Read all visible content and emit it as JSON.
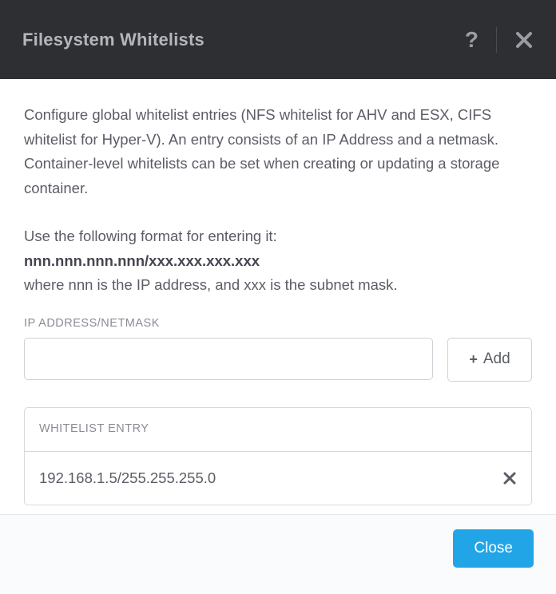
{
  "header": {
    "title": "Filesystem Whitelists",
    "help_tooltip": "?",
    "close_label": "Close"
  },
  "body": {
    "description": "Configure global whitelist entries (NFS whitelist for AHV and ESX, CIFS whitelist for Hyper-V). An entry consists of an IP Address and a netmask. Container-level whitelists can be set when creating or updating a storage container.",
    "format_intro": "Use the following format for entering it:",
    "format_example": "nnn.nnn.nnn.nnn/xxx.xxx.xxx.xxx",
    "format_note": "where nnn is the IP address, and xxx is the subnet mask.",
    "ip_label": "IP ADDRESS/NETMASK",
    "ip_value": "",
    "add_button_label": "Add",
    "list_header": "WHITELIST ENTRY",
    "entries": [
      {
        "value": "192.168.1.5/255.255.255.0"
      }
    ]
  },
  "footer": {
    "close_label": "Close"
  }
}
